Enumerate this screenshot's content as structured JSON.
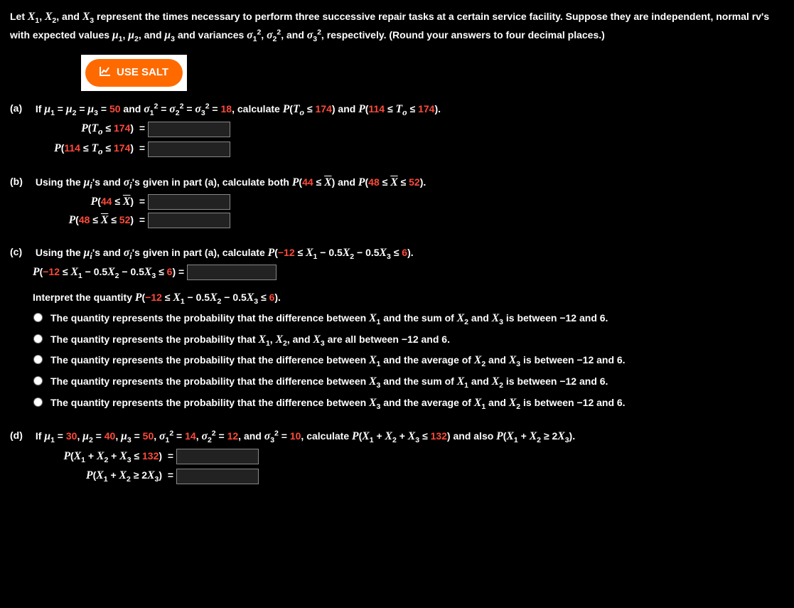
{
  "intro": {
    "full": "Let X₁, X₂, and X₃ represent the times necessary to perform three successive repair tasks at a certain service facility. Suppose they are independent, normal rv's with expected values μ₁, μ₂, and μ₃ and variances σ₁², σ₂², and σ₃², respectively. (Round your answers to four decimal places.)"
  },
  "salt": {
    "label": "USE SALT"
  },
  "a": {
    "label": "(a)",
    "p1": "If ",
    "p2": " = ",
    "val_mu": "50",
    "p3": " and ",
    "p4": " = ",
    "val_sigma": "18",
    "p5": ", calculate ",
    "p6": " and ",
    "p7": ".",
    "lhs1_pre": "P(",
    "lhs1_mid": " ≤ ",
    "lhs1_val": "174",
    "lhs1_post": ")  =",
    "lhs2_pre": "P(",
    "lhs2_a": "114",
    "lhs2_mid1": " ≤ ",
    "lhs2_mid2": " ≤ ",
    "lhs2_b": "174",
    "lhs2_post": ")  ="
  },
  "b": {
    "label": "(b)",
    "text_pre": "Using the ",
    "text_mid": "'s and ",
    "text_mid2": "'s given in part (a), calculate both ",
    "and": " and ",
    "period": ".",
    "p44": "P(44 ≤ X̄)  =",
    "p48": "P(48 ≤ X̄ ≤ 52)  =",
    "v44": "44",
    "v48": "48",
    "v52": "52"
  },
  "c": {
    "label": "(c)",
    "text_pre": "Using the ",
    "text_mid": "'s and ",
    "text_mid2": "'s given in part (a), calculate ",
    "period": ".",
    "neg12": "−12",
    "six": "6",
    "eq_label": ") =",
    "interpret_label": "Interpret the quantity ",
    "opts": [
      "The quantity represents the probability that the difference between X₁ and the sum of X₂ and X₃ is between −12 and 6.",
      "The quantity represents the probability that X₁, X₂, and X₃ are all between −12 and 6.",
      "The quantity represents the probability that the difference between X₁ and the average of X₂ and X₃ is between −12 and 6.",
      "The quantity represents the probability that the difference between X₃ and the sum of X₁ and X₂ is between −12 and 6.",
      "The quantity represents the probability that the difference between X₃ and the average of X₁ and X₂ is between −12 and 6."
    ]
  },
  "d": {
    "label": "(d)",
    "p_if": "If ",
    "mu1": "30",
    "mu2": "40",
    "mu3": "50",
    "s1": "14",
    "s2": "12",
    "s3": "10",
    "calc": ", calculate ",
    "and": " and also ",
    "v132": "132",
    "period": ".",
    "lhs1": ")  =",
    "lhs2": ")  ="
  }
}
